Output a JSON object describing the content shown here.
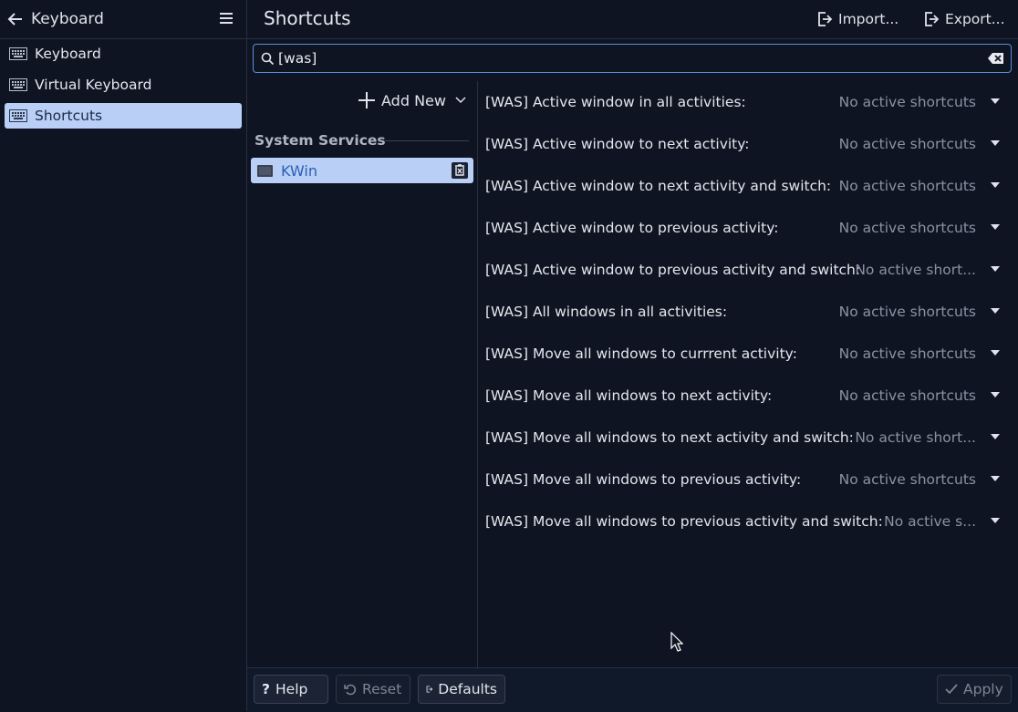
{
  "sidebar": {
    "back_label": "Keyboard",
    "items": [
      {
        "label": "Keyboard"
      },
      {
        "label": "Virtual Keyboard"
      },
      {
        "label": "Shortcuts"
      }
    ]
  },
  "header": {
    "title": "Shortcuts",
    "import_label": "Import...",
    "export_label": "Export..."
  },
  "search": {
    "value": "[was]"
  },
  "components": {
    "add_new_label": "Add New",
    "section_title": "System Services",
    "selected_item": "KWin"
  },
  "shortcuts": [
    {
      "name": "[WAS] Active window in all activities:",
      "status": "No active shortcuts"
    },
    {
      "name": "[WAS] Active window to next activity:",
      "status": "No active shortcuts"
    },
    {
      "name": "[WAS] Active window to next activity and switch:",
      "status": "No active shortcuts"
    },
    {
      "name": "[WAS] Active window to previous activity:",
      "status": "No active shortcuts"
    },
    {
      "name": "[WAS] Active window to previous activity and switch:",
      "status": "No active short..."
    },
    {
      "name": "[WAS] All windows in all activities:",
      "status": "No active shortcuts"
    },
    {
      "name": "[WAS] Move all windows to currrent activity:",
      "status": "No active shortcuts"
    },
    {
      "name": "[WAS] Move all windows to next activity:",
      "status": "No active shortcuts"
    },
    {
      "name": "[WAS] Move all windows to next activity and switch:",
      "status": "No active short..."
    },
    {
      "name": "[WAS] Move all windows to previous activity:",
      "status": "No active shortcuts"
    },
    {
      "name": "[WAS] Move all windows to previous activity and switch:",
      "status": "No active s..."
    }
  ],
  "footer": {
    "help_label": "Help",
    "reset_label": "Reset",
    "defaults_label": "Defaults",
    "apply_label": "Apply"
  },
  "colors": {
    "background": "#0f1422",
    "selection": "#b9cff5",
    "accent": "#5a8ed8"
  }
}
